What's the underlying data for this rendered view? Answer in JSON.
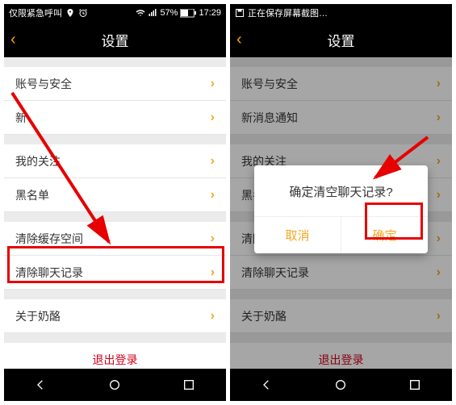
{
  "left": {
    "status": {
      "carrier": "仅限紧急呼叫",
      "battery": "57%",
      "time": "17:29"
    },
    "header": {
      "title": "设置",
      "back": "‹"
    },
    "items": {
      "account": "账号与安全",
      "new": "新",
      "follow": "我的关注",
      "blacklist": "黑名单",
      "cache": "清除缓存空间",
      "chatlog": "清除聊天记录",
      "about": "关于奶酪"
    },
    "logout": "退出登录"
  },
  "right": {
    "status": {
      "saving": "正在保存屏幕截图…"
    },
    "header": {
      "title": "设置",
      "back": "‹"
    },
    "items": {
      "account": "账号与安全",
      "notify": "新消息通知",
      "follow": "我的关注",
      "blacklist": "黑名",
      "cache": "清除",
      "chatlog": "清除聊天记录",
      "about": "关于奶酪"
    },
    "dialog": {
      "message": "确定清空聊天记录?",
      "cancel": "取消",
      "confirm": "确定"
    },
    "logout": "退出登录"
  },
  "chevron": "›"
}
